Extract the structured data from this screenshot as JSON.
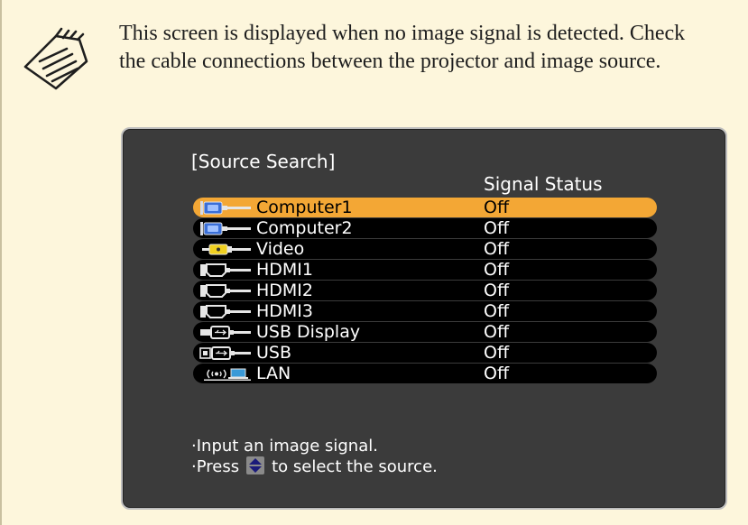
{
  "note": {
    "icon": "memo-icon",
    "text": "This screen is displayed when no image signal is detected. Check the cable connections between the projector and image source."
  },
  "osd": {
    "title": "[Source Search]",
    "column_header": "Signal Status",
    "sources": [
      {
        "name": "Computer1",
        "status": "Off",
        "icon": "computer-port-icon",
        "selected": true
      },
      {
        "name": "Computer2",
        "status": "Off",
        "icon": "computer-port-icon",
        "selected": false
      },
      {
        "name": "Video",
        "status": "Off",
        "icon": "video-port-icon",
        "selected": false
      },
      {
        "name": "HDMI1",
        "status": "Off",
        "icon": "hdmi-port-icon",
        "selected": false
      },
      {
        "name": "HDMI2",
        "status": "Off",
        "icon": "hdmi-port-icon",
        "selected": false
      },
      {
        "name": "HDMI3",
        "status": "Off",
        "icon": "hdmi-port-icon",
        "selected": false
      },
      {
        "name": "USB Display",
        "status": "Off",
        "icon": "usb-display-port-icon",
        "selected": false
      },
      {
        "name": "USB",
        "status": "Off",
        "icon": "usb-port-icon",
        "selected": false
      },
      {
        "name": "LAN",
        "status": "Off",
        "icon": "lan-wireless-icon",
        "selected": false
      }
    ],
    "help": {
      "line1": "·Input an image signal.",
      "line2_prefix": "·Press",
      "line2_key_icon": "up-down-arrow-key-icon",
      "line2_suffix": "to select the source."
    },
    "colors": {
      "selected_row": "#f3a735",
      "row": "#000000",
      "panel": "#3b3b3b",
      "note_background": "#fdf6dc"
    }
  }
}
